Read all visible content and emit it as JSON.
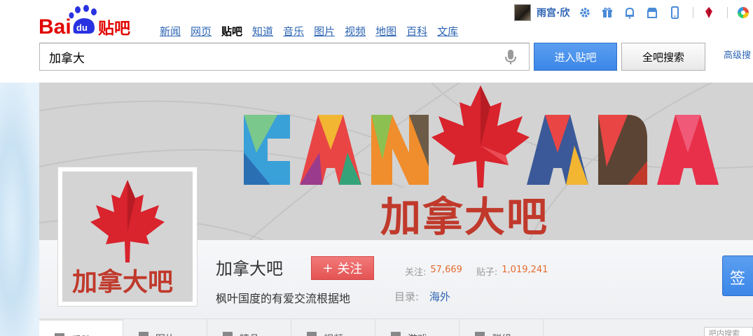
{
  "brand": {
    "logo_text_a": "Bai",
    "logo_text_b": "du",
    "logo_suffix": "贴吧"
  },
  "nav": [
    "新闻",
    "网页",
    "贴吧",
    "知道",
    "音乐",
    "图片",
    "视频",
    "地图",
    "百科",
    "文库"
  ],
  "nav_active_index": 2,
  "user": {
    "name": "雨宫·欣"
  },
  "search": {
    "value": "加拿大",
    "enter_label": "进入贴吧",
    "all_label": "全吧搜索",
    "advanced_label": "高级搜"
  },
  "banner": {
    "word": "CANADA",
    "subtitle": "加拿大吧"
  },
  "forum": {
    "name": "加拿大吧",
    "follow_label": "关注",
    "follow_prefix": "+",
    "follows_label": "关注:",
    "follows_count": "57,669",
    "posts_label": "贴子:",
    "posts_count": "1,019,241",
    "slogan": "枫叶国度的有爱交流根据地",
    "category_label": "目录:",
    "category_value": "海外",
    "right_btn_label": "签",
    "avatar_text": "加拿大吧"
  },
  "tabs": [
    "看贴",
    "图片",
    "精品",
    "视频",
    "游戏",
    "群组"
  ],
  "mini_search_placeholder": "吧内搜索",
  "colors": {
    "accent": "#3b86e8",
    "follow": "#e45353",
    "maple": "#d9232d",
    "link": "#2d64b3",
    "count": "#e56a2f"
  }
}
